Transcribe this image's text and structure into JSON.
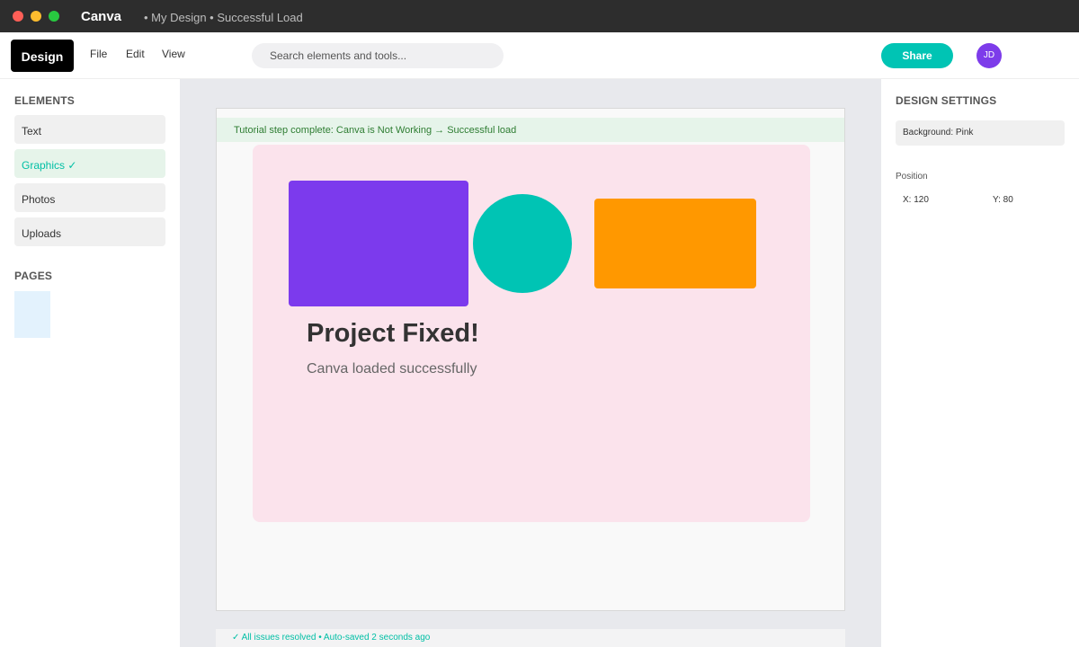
{
  "window": {
    "app_name": "Canva",
    "document_title": "• My Design • Successful Load"
  },
  "toolbar": {
    "design_label": "Design",
    "menu": [
      "File",
      "Edit",
      "View"
    ],
    "search_placeholder": "Search elements and tools...",
    "share_label": "Share",
    "avatar_initials": "JD"
  },
  "left_sidebar": {
    "elements_title": "ELEMENTS",
    "items": [
      {
        "label": "Text",
        "active": false
      },
      {
        "label": "Graphics ✓",
        "active": true
      },
      {
        "label": "Photos",
        "active": false
      },
      {
        "label": "Uploads",
        "active": false
      }
    ],
    "pages_title": "PAGES"
  },
  "canvas": {
    "banner": "Tutorial step complete: Canva is Not Working → Successful load",
    "heading": "Project Fixed!",
    "subheading": "Canva loaded successfully",
    "status": "✓ All issues resolved • Auto-saved 2 seconds ago"
  },
  "right_sidebar": {
    "title": "DESIGN SETTINGS",
    "background": "Background: Pink",
    "position_label": "Position",
    "x": "X: 120",
    "y": "Y: 80"
  },
  "colors": {
    "brand": "#00c4b4",
    "purple": "#7c3aed",
    "orange": "#ff9800",
    "canvas_pink": "#fbe3ec"
  }
}
